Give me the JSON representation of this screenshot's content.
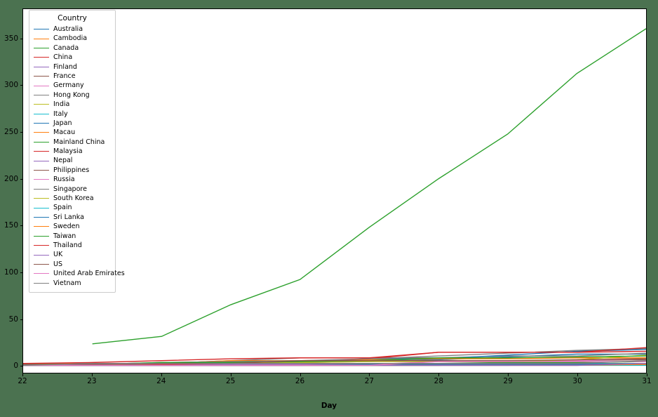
{
  "figure": {
    "background_color": "#4b7250",
    "axes_background_color": "#ffffff"
  },
  "legend": {
    "title": "Country",
    "border_color": "#cccccc"
  },
  "axis": {
    "x_title": "Day",
    "x_ticks": [
      "22",
      "23",
      "24",
      "25",
      "26",
      "27",
      "28",
      "29",
      "30",
      "31"
    ],
    "y_ticks": [
      "0",
      "50",
      "100",
      "150",
      "200",
      "250",
      "300",
      "350"
    ]
  },
  "chart_data": {
    "type": "line",
    "title": "",
    "xlabel": "Day",
    "ylabel": "",
    "xlim": [
      22,
      31
    ],
    "ylim": [
      -8,
      382
    ],
    "grid": false,
    "legend_position": "upper left",
    "legend_title": "Country",
    "x": [
      22,
      23,
      24,
      25,
      26,
      27,
      28,
      29,
      30,
      31
    ],
    "series": [
      {
        "name": "Australia",
        "color": "#1f77b4",
        "values": [
          0,
          0,
          0,
          4,
          4,
          5,
          6,
          9,
          12,
          12
        ]
      },
      {
        "name": "Cambodia",
        "color": "#ff7f0e",
        "values": [
          0,
          0,
          0,
          0,
          1,
          1,
          1,
          1,
          1,
          1
        ]
      },
      {
        "name": "Canada",
        "color": "#2ca02c",
        "values": [
          0,
          0,
          0,
          1,
          1,
          2,
          2,
          3,
          3,
          4
        ]
      },
      {
        "name": "China",
        "color": "#d62728",
        "values": [
          1,
          1,
          1,
          1,
          1,
          1,
          1,
          1,
          1,
          1
        ]
      },
      {
        "name": "Finland",
        "color": "#9467bd",
        "values": [
          0,
          0,
          0,
          0,
          0,
          0,
          1,
          1,
          1,
          1
        ]
      },
      {
        "name": "France",
        "color": "#8c564b",
        "values": [
          0,
          0,
          2,
          3,
          3,
          4,
          5,
          5,
          5,
          6
        ]
      },
      {
        "name": "Germany",
        "color": "#e377c2",
        "values": [
          0,
          0,
          0,
          0,
          0,
          1,
          4,
          4,
          5,
          7
        ]
      },
      {
        "name": "Hong Kong",
        "color": "#7f7f7f",
        "values": [
          0,
          2,
          2,
          5,
          8,
          8,
          8,
          10,
          10,
          13
        ]
      },
      {
        "name": "India",
        "color": "#bcbd22",
        "values": [
          0,
          0,
          0,
          0,
          0,
          0,
          0,
          1,
          1,
          1
        ]
      },
      {
        "name": "Italy",
        "color": "#17becf",
        "values": [
          0,
          0,
          0,
          0,
          0,
          0,
          0,
          0,
          2,
          2
        ]
      },
      {
        "name": "Japan",
        "color": "#1f77b4",
        "values": [
          2,
          2,
          2,
          3,
          4,
          7,
          7,
          11,
          15,
          17
        ]
      },
      {
        "name": "Macau",
        "color": "#ff7f0e",
        "values": [
          1,
          2,
          2,
          5,
          5,
          6,
          7,
          7,
          8,
          8
        ]
      },
      {
        "name": "Mainland China",
        "color": "#2ca02c",
        "values": [
          null,
          23,
          31,
          65,
          92,
          148,
          200,
          248,
          313,
          361
        ]
      },
      {
        "name": "Malaysia",
        "color": "#d62728",
        "values": [
          0,
          0,
          3,
          4,
          4,
          7,
          14,
          14,
          14,
          15
        ]
      },
      {
        "name": "Nepal",
        "color": "#9467bd",
        "values": [
          0,
          0,
          0,
          1,
          1,
          1,
          1,
          1,
          1,
          1
        ]
      },
      {
        "name": "Philippines",
        "color": "#8c564b",
        "values": [
          0,
          0,
          0,
          0,
          0,
          0,
          0,
          1,
          1,
          2
        ]
      },
      {
        "name": "Russia",
        "color": "#e377c2",
        "values": [
          0,
          0,
          0,
          0,
          0,
          0,
          0,
          0,
          0,
          2
        ]
      },
      {
        "name": "Singapore",
        "color": "#7f7f7f",
        "values": [
          0,
          1,
          3,
          4,
          5,
          7,
          10,
          13,
          16,
          18
        ]
      },
      {
        "name": "South Korea",
        "color": "#bcbd22",
        "values": [
          1,
          1,
          2,
          2,
          3,
          4,
          4,
          4,
          6,
          11
        ]
      },
      {
        "name": "Spain",
        "color": "#17becf",
        "values": [
          0,
          0,
          0,
          0,
          0,
          0,
          0,
          0,
          0,
          0
        ]
      },
      {
        "name": "Sri Lanka",
        "color": "#1f77b4",
        "values": [
          0,
          0,
          0,
          0,
          0,
          1,
          1,
          1,
          1,
          1
        ]
      },
      {
        "name": "Sweden",
        "color": "#ff7f0e",
        "values": [
          0,
          0,
          0,
          0,
          0,
          0,
          0,
          0,
          0,
          1
        ]
      },
      {
        "name": "Taiwan",
        "color": "#2ca02c",
        "values": [
          1,
          1,
          3,
          3,
          4,
          5,
          8,
          8,
          9,
          10
        ]
      },
      {
        "name": "Thailand",
        "color": "#d62728",
        "values": [
          2,
          3,
          5,
          7,
          8,
          8,
          14,
          14,
          14,
          19
        ]
      },
      {
        "name": "UK",
        "color": "#9467bd",
        "values": [
          0,
          0,
          0,
          0,
          0,
          0,
          0,
          0,
          0,
          2
        ]
      },
      {
        "name": "US",
        "color": "#8c564b",
        "values": [
          1,
          1,
          2,
          2,
          5,
          5,
          5,
          5,
          6,
          7
        ]
      },
      {
        "name": "United Arab Emirates",
        "color": "#e377c2",
        "values": [
          0,
          0,
          0,
          0,
          0,
          0,
          4,
          4,
          4,
          4
        ]
      },
      {
        "name": "Vietnam",
        "color": "#7f7f7f",
        "values": [
          0,
          2,
          2,
          2,
          2,
          2,
          2,
          2,
          2,
          5
        ]
      }
    ]
  }
}
